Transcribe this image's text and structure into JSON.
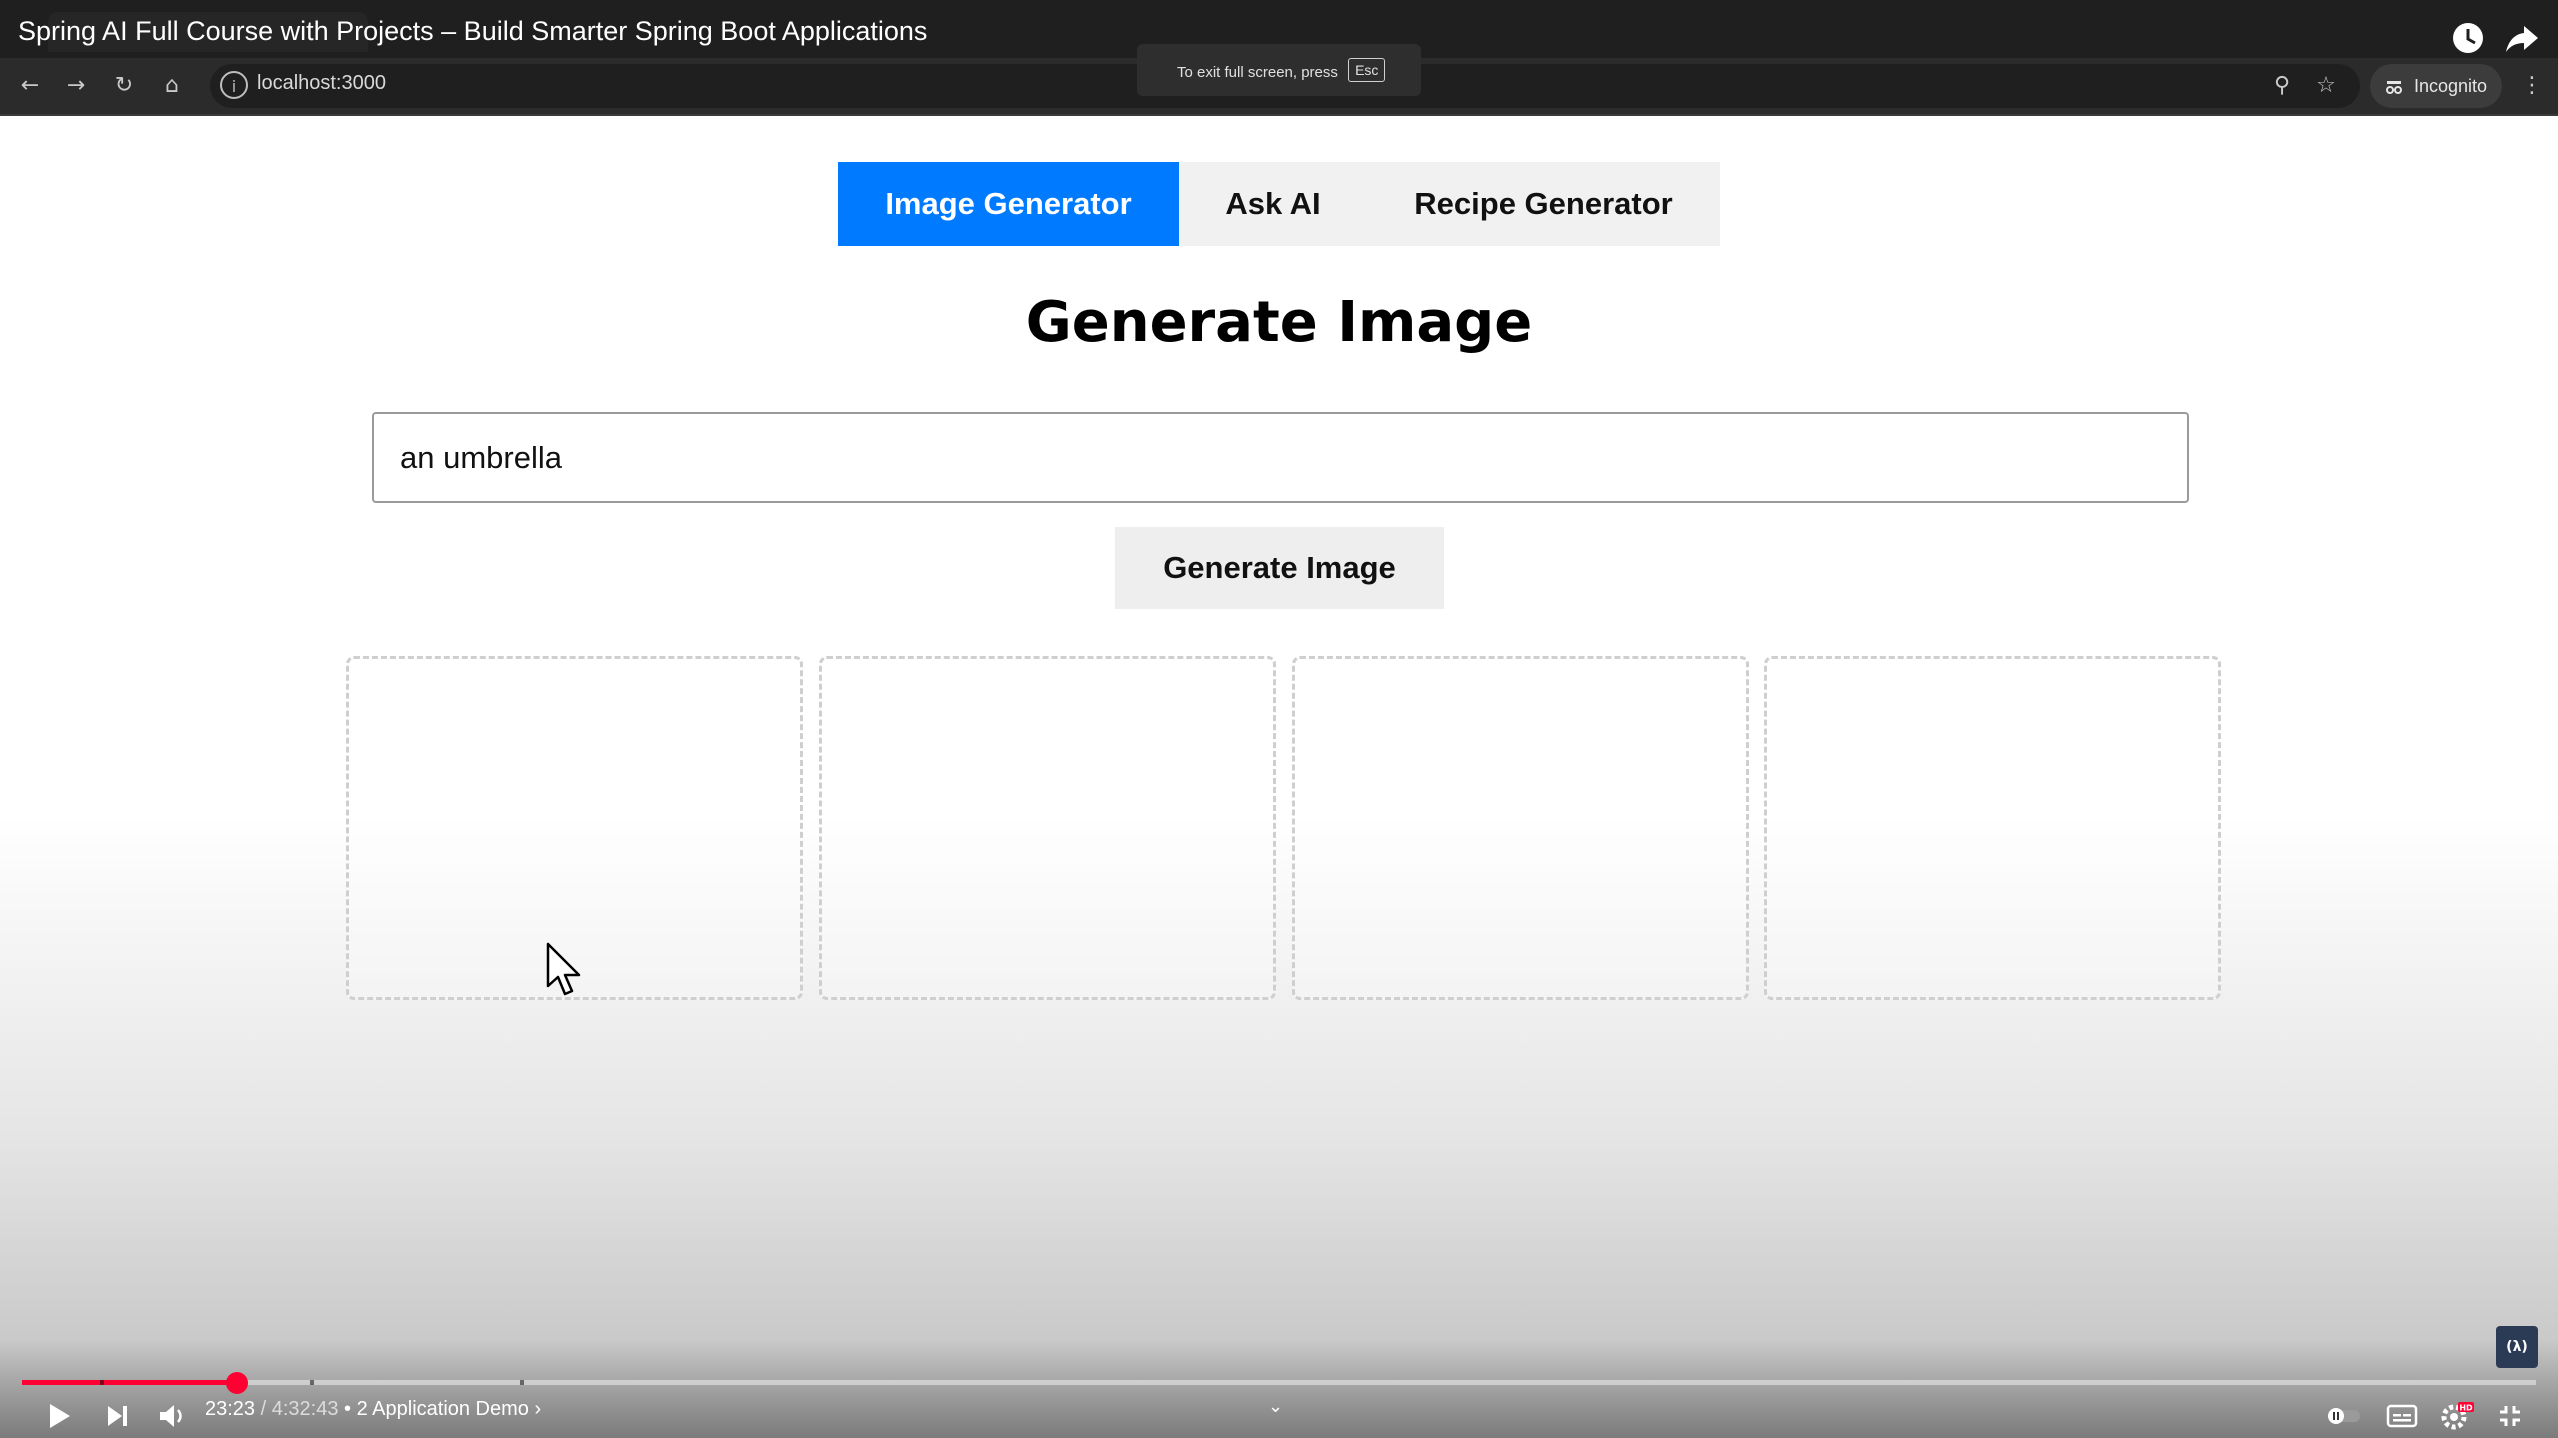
{
  "video": {
    "title": "Spring AI Full Course with Projects – Build Smarter Spring Boot Applications",
    "fullscreen_toast": "To exit full screen, press",
    "esc_key": "Esc"
  },
  "browser": {
    "url": "localhost:3000",
    "incognito_label": "Incognito"
  },
  "app": {
    "tabs": [
      {
        "label": "Image Generator",
        "active": true
      },
      {
        "label": "Ask AI",
        "active": false
      },
      {
        "label": "Recipe Generator",
        "active": false
      }
    ],
    "heading": "Generate Image",
    "prompt_value": "an umbrella",
    "button_label": "Generate Image",
    "image_slots": 4
  },
  "player": {
    "current_time": "23:23",
    "separator": " / ",
    "duration": "4:32:43",
    "chapter": " • 2 Application Demo ›",
    "progress_fraction": 0.0855
  },
  "colors": {
    "accent": "#007bff",
    "progress": "#ff0033"
  }
}
